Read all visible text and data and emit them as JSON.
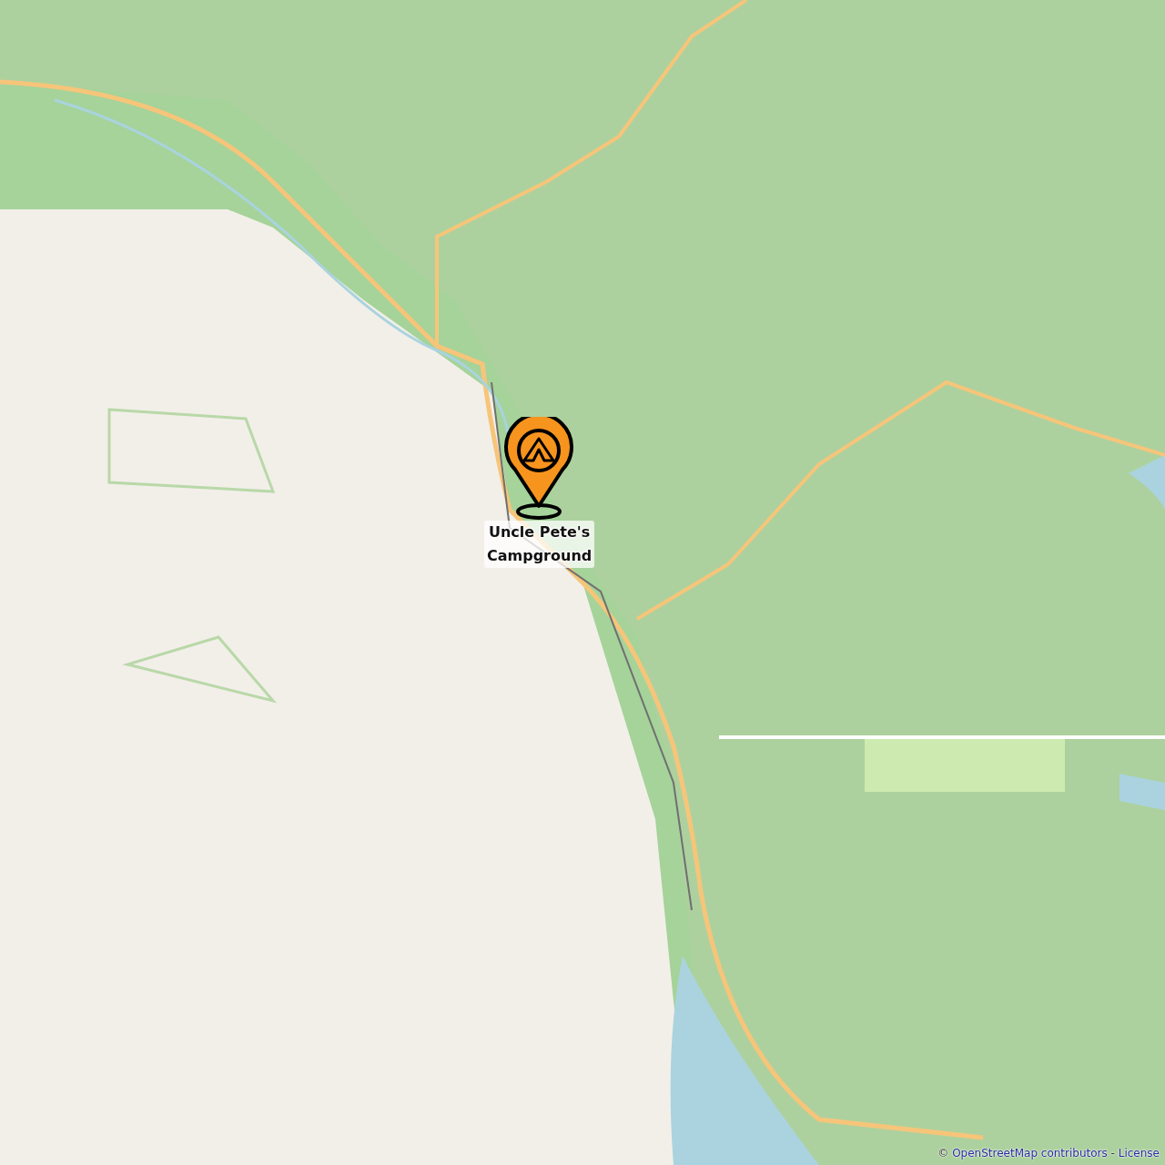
{
  "marker": {
    "label": "Uncle Pete's Campground"
  },
  "attribution": {
    "prefix": "©",
    "source_link": "OpenStreetMap contributors",
    "separator": "-",
    "license_link": "License"
  }
}
